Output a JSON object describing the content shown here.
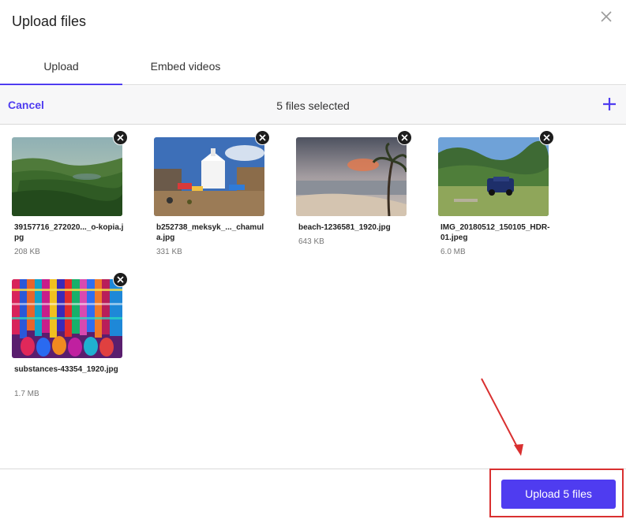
{
  "dialog": {
    "title": "Upload files",
    "close_icon": "close-icon"
  },
  "tabs": [
    {
      "label": "Upload",
      "active": true
    },
    {
      "label": "Embed videos",
      "active": false
    }
  ],
  "toolbar": {
    "cancel_label": "Cancel",
    "selection_status": "5 files selected",
    "add_icon": "plus-icon"
  },
  "files": [
    {
      "name": "39157716_272020..._o-kopia.jpg",
      "size": "208 KB",
      "thumbnail": "green-valley-landscape"
    },
    {
      "name": "b252738_meksyk_..._chamula.jpg",
      "size": "331 KB",
      "thumbnail": "white-church-market"
    },
    {
      "name": "beach-1236581_1920.jpg",
      "size": "643 KB",
      "thumbnail": "beach-palm-sunset"
    },
    {
      "name": "IMG_20180512_150105_HDR-01.jpeg",
      "size": "6.0 MB",
      "thumbnail": "mountain-meadow-car"
    },
    {
      "name": "substances-43354_1920.jpg",
      "size": "1.7 MB",
      "thumbnail": "colorful-fabric-rolls"
    }
  ],
  "footer": {
    "upload_label": "Upload 5 files"
  },
  "colors": {
    "accent": "#4f3cf0",
    "annotation": "#d93030"
  }
}
